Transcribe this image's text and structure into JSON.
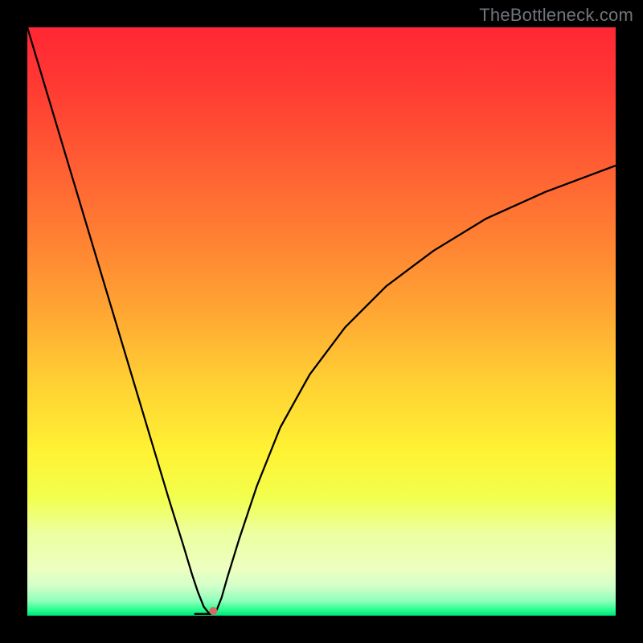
{
  "watermark": "TheBottleneck.com",
  "chart_data": {
    "type": "line",
    "title": "",
    "xlabel": "",
    "ylabel": "",
    "xlim": [
      0,
      100
    ],
    "ylim": [
      0,
      100
    ],
    "gradient_stops": [
      {
        "offset": 0.0,
        "color": "#ff2734"
      },
      {
        "offset": 0.1,
        "color": "#ff3a33"
      },
      {
        "offset": 0.22,
        "color": "#ff5a33"
      },
      {
        "offset": 0.35,
        "color": "#ff7e33"
      },
      {
        "offset": 0.48,
        "color": "#ffa533"
      },
      {
        "offset": 0.6,
        "color": "#ffcf33"
      },
      {
        "offset": 0.72,
        "color": "#fff233"
      },
      {
        "offset": 0.8,
        "color": "#f2ff4e"
      },
      {
        "offset": 0.86,
        "color": "#ecffa0"
      },
      {
        "offset": 0.92,
        "color": "#edffbf"
      },
      {
        "offset": 0.95,
        "color": "#d2ffc9"
      },
      {
        "offset": 0.975,
        "color": "#8fffbb"
      },
      {
        "offset": 0.99,
        "color": "#28ff8f"
      },
      {
        "offset": 1.0,
        "color": "#00e27a"
      }
    ],
    "series": [
      {
        "name": "curve",
        "type": "line",
        "x": [
          0.0,
          3.0,
          6.0,
          9.0,
          12.0,
          15.0,
          18.0,
          21.0,
          24.0,
          26.5,
          28.0,
          29.0,
          30.0,
          30.8,
          31.5,
          32.2,
          33.0,
          34.0,
          36.0,
          39.0,
          43.0,
          48.0,
          54.0,
          61.0,
          69.0,
          78.0,
          88.0,
          100.0
        ],
        "y": [
          100.0,
          90.0,
          80.0,
          70.0,
          60.0,
          50.0,
          40.0,
          30.0,
          20.0,
          12.0,
          7.0,
          4.0,
          1.5,
          0.5,
          0.5,
          1.0,
          3.0,
          6.5,
          13.0,
          22.0,
          32.0,
          41.0,
          49.0,
          56.0,
          62.0,
          67.5,
          72.0,
          76.5
        ]
      },
      {
        "name": "floor-dash",
        "type": "line",
        "x": [
          28.5,
          31.2
        ],
        "y": [
          0.3,
          0.3
        ]
      }
    ],
    "marker": {
      "x": 31.6,
      "y": 0.8,
      "color": "#d46a63",
      "size": 10
    }
  }
}
